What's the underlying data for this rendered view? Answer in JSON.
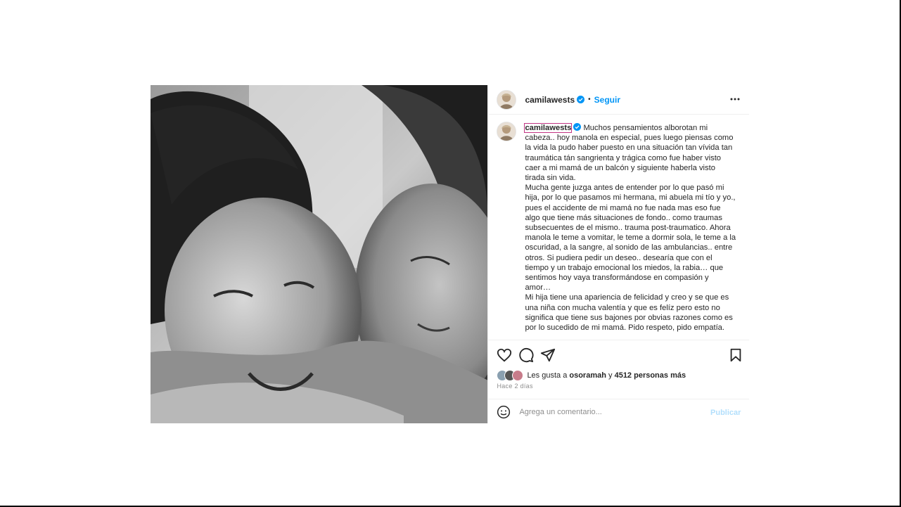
{
  "post": {
    "username": "camilawests",
    "dot": "•",
    "follow_label": "Seguir",
    "more_icon": "more-horizontal-icon",
    "verified_icon": "verified-badge-icon",
    "caption_username": "camilawests",
    "caption": "Muchos pensamientos alborotan mi cabeza.. hoy manola en especial, pues luego piensas como la vida la pudo haber puesto en una situación tan vívida tan traumática tán sangrienta y trágica como fue haber visto caer a mi mamá de un balcón y siguiente haberla visto tirada sin vida.\nMucha gente juzga antes de entender por lo que pasó mi hija, por lo que pasamos mi hermana, mi abuela mi tío y yo., pues el accidente de mi mamá no fue nada mas eso fue algo que tiene más situaciones de fondo.. como traumas subsecuentes de el mismo.. trauma post-traumatico. Ahora manola le teme a vomitar, le teme a dormir sola, le teme a la oscuridad, a la sangre, al sonido de las ambulancias.. entre otros. Si pudiera pedir un deseo.. desearía que con el tiempo y un trabajo emocional los miedos, la rabia… que sentimos hoy vaya transformándose en compasión y amor…\nMi hija tiene una apariencia de felicidad y creo y se que es una niña con mucha valentía y que es felíz pero esto no significa que tiene sus bajones por obvias razones como es por lo sucedido de mi mamá. Pido respeto, pido empatía.",
    "image_description_icon": "photo"
  },
  "actions": {
    "like_icon": "heart-icon",
    "comment_icon": "comment-icon",
    "share_icon": "share-icon",
    "save_icon": "bookmark-icon"
  },
  "likes": {
    "prefix": "Les gusta a ",
    "first_user": "osoramah",
    "middle": " y ",
    "others": "4512 personas más"
  },
  "timestamp": "Hace 2 días",
  "comment_box": {
    "placeholder": "Agrega un comentario...",
    "publish_label": "Publicar",
    "emoji_icon": "emoji-icon"
  },
  "colors": {
    "accent": "#0095f6",
    "publish_disabled": "#b2dffc",
    "highlight_outline": "#c13584"
  }
}
